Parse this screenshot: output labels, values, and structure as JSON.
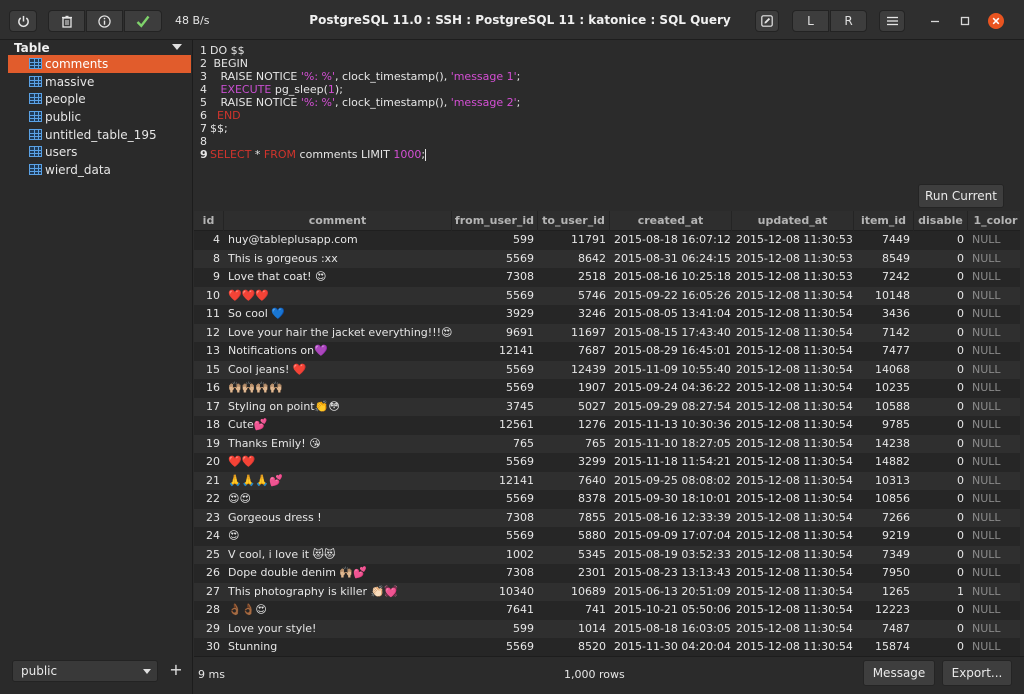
{
  "toolbar": {
    "rate": "48 B/s",
    "title": "PostgreSQL 11.0 : SSH : PostgreSQL 11 : katonice : SQL Query",
    "left_panel_label": "L",
    "right_panel_label": "R",
    "icons": [
      "power-icon",
      "trash-icon",
      "info-icon",
      "check-icon",
      "edit-icon",
      "menu-icon",
      "minimize-icon",
      "maximize-icon",
      "close-icon"
    ],
    "close_color": "#e95420",
    "check_color": "#7fd36b"
  },
  "sidebar": {
    "header": "Table",
    "items": [
      {
        "label": "comments",
        "active": true
      },
      {
        "label": "massive"
      },
      {
        "label": "people"
      },
      {
        "label": "public"
      },
      {
        "label": "untitled_table_195"
      },
      {
        "label": "users"
      },
      {
        "label": "wierd_data"
      }
    ],
    "schema": "public",
    "add_label": "+",
    "accent": "#e15c2c"
  },
  "editor": {
    "lines": [
      {
        "n": "1",
        "parts": [
          {
            "t": "DO $$",
            "c": ""
          }
        ]
      },
      {
        "n": "2",
        "parts": [
          {
            "t": " BEGIN",
            "c": ""
          }
        ]
      },
      {
        "n": "3",
        "parts": [
          {
            "t": "   RAISE NOTICE ",
            "c": ""
          },
          {
            "t": "'%: %'",
            "c": "str"
          },
          {
            "t": ", clock_timestamp(), ",
            "c": ""
          },
          {
            "t": "'message 1'",
            "c": "str"
          },
          {
            "t": ";",
            "c": ""
          }
        ]
      },
      {
        "n": "4",
        "parts": [
          {
            "t": "   ",
            "c": ""
          },
          {
            "t": "EXECUTE",
            "c": "kw2"
          },
          {
            "t": " pg_sleep(",
            "c": ""
          },
          {
            "t": "1",
            "c": "num"
          },
          {
            "t": ");",
            "c": ""
          }
        ]
      },
      {
        "n": "5",
        "parts": [
          {
            "t": "   RAISE NOTICE ",
            "c": ""
          },
          {
            "t": "'%: %'",
            "c": "str"
          },
          {
            "t": ", clock_timestamp(), ",
            "c": ""
          },
          {
            "t": "'message 2'",
            "c": "str"
          },
          {
            "t": ";",
            "c": ""
          }
        ]
      },
      {
        "n": "6",
        "parts": [
          {
            "t": "  ",
            "c": ""
          },
          {
            "t": "END",
            "c": "kw"
          }
        ]
      },
      {
        "n": "7",
        "parts": [
          {
            "t": "$$;",
            "c": ""
          }
        ]
      },
      {
        "n": "8",
        "parts": [
          {
            "t": "",
            "c": ""
          }
        ]
      },
      {
        "n": "9",
        "current": true,
        "parts": [
          {
            "t": "SELECT",
            "c": "kw"
          },
          {
            "t": " * ",
            "c": ""
          },
          {
            "t": "FROM",
            "c": "kw"
          },
          {
            "t": " comments LIMIT ",
            "c": ""
          },
          {
            "t": "1000",
            "c": "num"
          },
          {
            "t": ";",
            "c": ""
          }
        ]
      }
    ],
    "run_label": "Run Current"
  },
  "grid": {
    "columns": [
      "id",
      "comment",
      "from_user_id",
      "to_user_id",
      "created_at",
      "updated_at",
      "item_id",
      "disable",
      "1_color"
    ],
    "rows": [
      [
        "4",
        "huy@tableplusapp.com",
        "599",
        "11791",
        "2015-08-18 16:07:12",
        "2015-12-08 11:30:53",
        "7449",
        "0",
        "NULL"
      ],
      [
        "8",
        "This is gorgeous :xx",
        "5569",
        "8642",
        "2015-08-31 06:24:15",
        "2015-12-08 11:30:53",
        "8549",
        "0",
        "NULL"
      ],
      [
        "9",
        "Love that coat! 😍",
        "7308",
        "2518",
        "2015-08-16 10:25:18",
        "2015-12-08 11:30:53",
        "7242",
        "0",
        "NULL"
      ],
      [
        "10",
        "❤️❤️❤️",
        "5569",
        "5746",
        "2015-09-22 16:05:26",
        "2015-12-08 11:30:54",
        "10148",
        "0",
        "NULL"
      ],
      [
        "11",
        "So cool 💙",
        "3929",
        "3246",
        "2015-08-05 13:41:04",
        "2015-12-08 11:30:54",
        "3436",
        "0",
        "NULL"
      ],
      [
        "12",
        "Love your hair the jacket everything!!!😍",
        "9691",
        "11697",
        "2015-08-15 17:43:40",
        "2015-12-08 11:30:54",
        "7142",
        "0",
        "NULL"
      ],
      [
        "13",
        "Notifications on💜",
        "12141",
        "7687",
        "2015-08-29 16:45:01",
        "2015-12-08 11:30:54",
        "7477",
        "0",
        "NULL"
      ],
      [
        "15",
        "Cool jeans! ❤️",
        "5569",
        "12439",
        "2015-11-09 10:55:40",
        "2015-12-08 11:30:54",
        "14068",
        "0",
        "NULL"
      ],
      [
        "16",
        "🙌🏼🙌🏼🙌🏼🙌🏼",
        "5569",
        "1907",
        "2015-09-24 04:36:22",
        "2015-12-08 11:30:54",
        "10235",
        "0",
        "NULL"
      ],
      [
        "17",
        "Styling on point👏😳",
        "3745",
        "5027",
        "2015-09-29 08:27:54",
        "2015-12-08 11:30:54",
        "10588",
        "0",
        "NULL"
      ],
      [
        "18",
        "Cute💕",
        "12561",
        "1276",
        "2015-11-13 10:30:36",
        "2015-12-08 11:30:54",
        "9785",
        "0",
        "NULL"
      ],
      [
        "19",
        "Thanks Emily! 😘",
        "765",
        "765",
        "2015-11-10 18:27:05",
        "2015-12-08 11:30:54",
        "14238",
        "0",
        "NULL"
      ],
      [
        "20",
        "❤️❤️",
        "5569",
        "3299",
        "2015-11-18 11:54:21",
        "2015-12-08 11:30:54",
        "14882",
        "0",
        "NULL"
      ],
      [
        "21",
        "🙏🙏🙏💕",
        "12141",
        "7640",
        "2015-09-25 08:08:02",
        "2015-12-08 11:30:54",
        "10313",
        "0",
        "NULL"
      ],
      [
        "22",
        "😍😍",
        "5569",
        "8378",
        "2015-09-30 18:10:01",
        "2015-12-08 11:30:54",
        "10856",
        "0",
        "NULL"
      ],
      [
        "23",
        "Gorgeous dress !",
        "7308",
        "7855",
        "2015-08-16 12:33:39",
        "2015-12-08 11:30:54",
        "7266",
        "0",
        "NULL"
      ],
      [
        "24",
        "😍",
        "5569",
        "5880",
        "2015-09-09 17:07:04",
        "2015-12-08 11:30:54",
        "9219",
        "0",
        "NULL"
      ],
      [
        "25",
        "V cool, i love it 😻😻",
        "1002",
        "5345",
        "2015-08-19 03:52:33",
        "2015-12-08 11:30:54",
        "7349",
        "0",
        "NULL"
      ],
      [
        "26",
        "Dope double denim 🙌🏼💕",
        "7308",
        "2301",
        "2015-08-23 13:13:43",
        "2015-12-08 11:30:54",
        "7950",
        "0",
        "NULL"
      ],
      [
        "27",
        "This photography is killer 👏🏻💓",
        "10340",
        "10689",
        "2015-06-13 20:51:09",
        "2015-12-08 11:30:54",
        "1265",
        "1",
        "NULL"
      ],
      [
        "28",
        "👌🏾👌🏾😍",
        "7641",
        "741",
        "2015-10-21 05:50:06",
        "2015-12-08 11:30:54",
        "12223",
        "0",
        "NULL"
      ],
      [
        "29",
        "Love your style!",
        "599",
        "1014",
        "2015-08-18 16:03:05",
        "2015-12-08 11:30:54",
        "7487",
        "0",
        "NULL"
      ],
      [
        "30",
        "Stunning",
        "5569",
        "8520",
        "2015-11-30 04:20:04",
        "2015-12-08 11:30:54",
        "15874",
        "0",
        "NULL"
      ]
    ]
  },
  "status": {
    "time": "9 ms",
    "row_count": "1,000 rows",
    "message_label": "Message",
    "export_label": "Export..."
  }
}
